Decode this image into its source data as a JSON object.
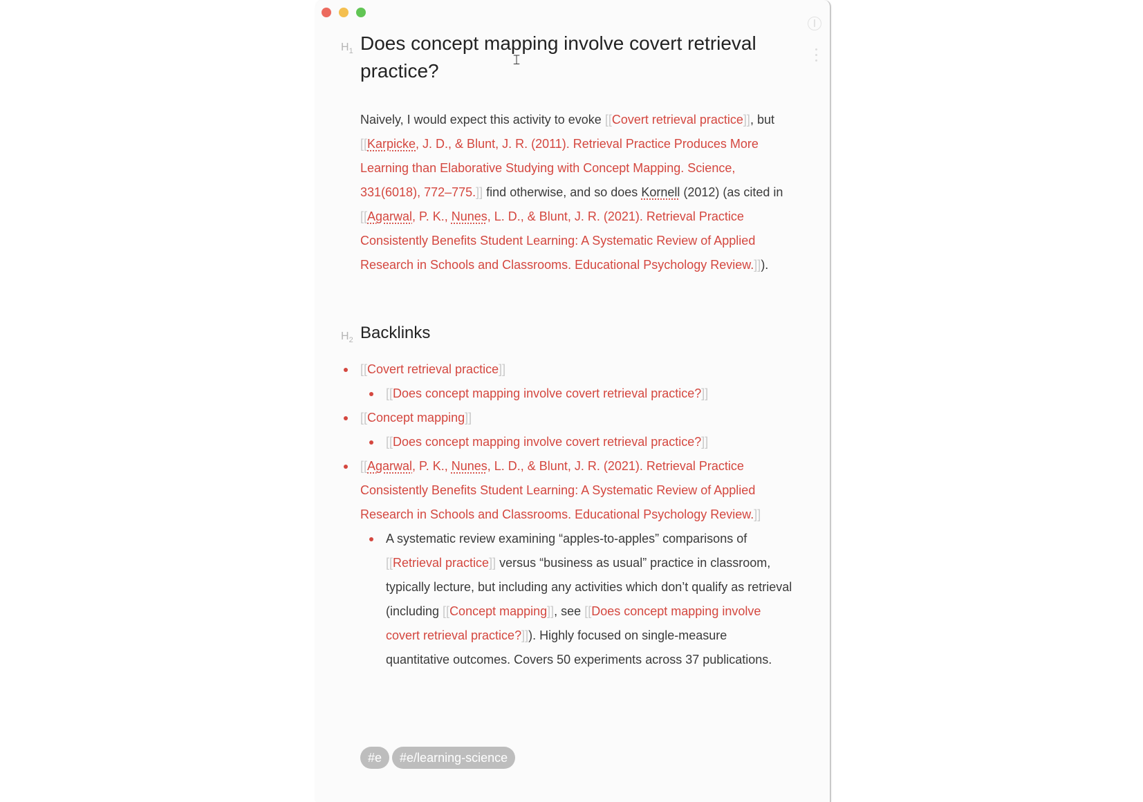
{
  "window": {
    "buttons": [
      "close",
      "minimize",
      "maximize"
    ]
  },
  "note": {
    "heading_markers": {
      "h1": "H",
      "h1_sub": "1",
      "h2": "H",
      "h2_sub": "2"
    },
    "title": "Does concept mapping involve covert retrieval practice?",
    "paragraph": {
      "t1": "Naively, I would expect this activity to evoke ",
      "l1": "Covert retrieval practice",
      "t2": ", but ",
      "l2a": "Karpicke",
      "l2b": ", J. D., & Blunt, J. R. (2011). Retrieval Practice Produces More Learning than Elaborative Studying with Concept Mapping. Science, 331(6018), 772–775.",
      "t3": " find otherwise, and so does ",
      "t4": "Kornell",
      "t5": " (2012) (as cited in ",
      "l3a": "Agarwal",
      "l3b": ", P. K., ",
      "l3c": "Nunes",
      "l3d": ", L. D., & Blunt, J. R. (2021). Retrieval Practice Consistently Benefits Student Learning: A Systematic Review of Applied Research in Schools and Classrooms. Educational Psychology Review.",
      "t6": ")."
    },
    "backlinks_heading": "Backlinks",
    "backlinks": {
      "b1": "Covert retrieval practice",
      "b1_child": "Does concept mapping involve covert retrieval practice?",
      "b2": "Concept mapping",
      "b2_child": "Does concept mapping involve covert retrieval practice?",
      "b3a": "Agarwal",
      "b3b": ", P. K., ",
      "b3c": "Nunes",
      "b3d": ", L. D., & Blunt, J. R. (2021). Retrieval Practice Consistently Benefits Student Learning: A Systematic Review of Applied Research in Schools and Classrooms. Educational Psychology Review.",
      "b3_child": {
        "t1": "A systematic review examining “apples-to-apples” comparisons of ",
        "l1": "Retrieval practice",
        "t2": " versus “business as usual” practice in classroom, typically lecture, but including any activities which don’t qualify as retrieval (including ",
        "l2": "Concept mapping",
        "t3": ", see ",
        "l3": "Does concept mapping involve covert retrieval practice?",
        "t4": "). Highly focused on single-measure quantitative outcomes. Covers 50 experiments across 37 publications."
      }
    },
    "tags": [
      "#e",
      "#e/learning-science"
    ],
    "link_brackets": {
      "open": "[[",
      "close": "]]"
    },
    "colors": {
      "link": "#d4473f",
      "bracket": "#c9c9c9",
      "tag_bg": "#bdbdbd"
    }
  }
}
